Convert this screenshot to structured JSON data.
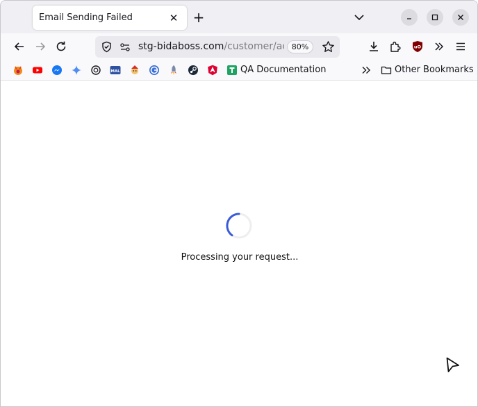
{
  "tab": {
    "title": "Email Sending Failed"
  },
  "url": {
    "host": "stg-bidaboss.com",
    "path": "/customer/account"
  },
  "zoom": {
    "level": "80%"
  },
  "bookmarks": {
    "items": [
      {
        "label": "QA Documentation",
        "icon": "google-sheets-icon"
      }
    ],
    "other_label": "Other Bookmarks"
  },
  "page": {
    "status_text": "Processing your request..."
  },
  "colors": {
    "spinner": "#3a5bd9",
    "addon_red": "#c40010"
  }
}
